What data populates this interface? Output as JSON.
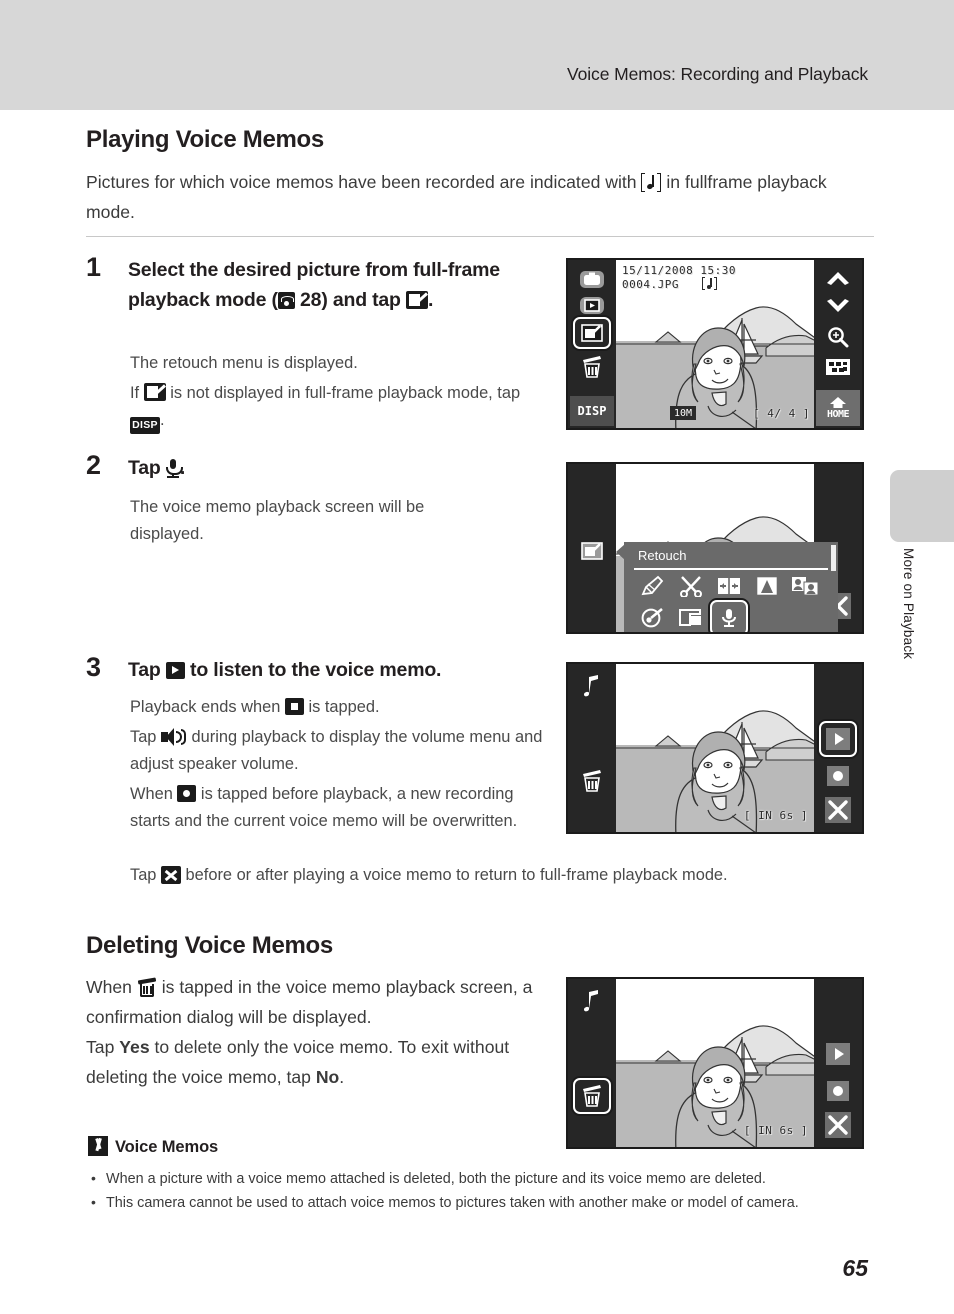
{
  "header": {
    "title": "Voice Memos: Recording and Playback"
  },
  "side_tab": {
    "label": "More on Playback"
  },
  "page_number": "65",
  "sections": {
    "playing": {
      "heading": "Playing Voice Memos",
      "lead_part1": "Pictures for which voice memos have been recorded are indicated with ",
      "lead_part2": " in fullframe playback mode.",
      "steps": [
        {
          "number": "1",
          "title_part1": "Select the desired picture from full-frame playback mode (",
          "title_part2": " 28) and tap ",
          "title_part3": ".",
          "body_line1": "The retouch menu is displayed.",
          "body_line2_part1": "If ",
          "body_line2_part2": " is not displayed in full-frame playback mode, tap ",
          "body_line2_part3": ".",
          "disp_label": "DISP"
        },
        {
          "number": "2",
          "title_part1": "Tap ",
          "title_part3": ".",
          "body_line1": "The voice memo playback screen will be displayed."
        },
        {
          "number": "3",
          "title_part1": "Tap ",
          "title_part3": " to listen to the voice memo.",
          "body_line1_part1": "Playback ends when ",
          "body_line1_part2": " is tapped.",
          "body_line2_part1": "Tap ",
          "body_line2_part2": " during playback to display the volume menu and adjust speaker volume.",
          "body_line3_part1": "When ",
          "body_line3_part2": " is tapped before playback, a new recording starts and the current voice memo will be overwritten.",
          "body_line4_part1": "Tap ",
          "body_line4_part2": " before or after playing a voice memo to return to full-frame playback mode."
        }
      ]
    },
    "deleting": {
      "heading": "Deleting Voice Memos",
      "para1_part1": "When ",
      "para1_part2": " is tapped in the voice memo playback screen, a confirmation dialog will be displayed.",
      "para2_part1": "Tap ",
      "para2_yes": "Yes",
      "para2_part2": " to delete only the voice memo. To exit without deleting the voice memo, tap ",
      "para2_no": "No",
      "para2_part3": "."
    },
    "note": {
      "title": "Voice Memos",
      "bullets": [
        "When a picture with a voice memo attached is deleted, both the picture and its voice memo are deleted.",
        "This camera cannot be used to attach voice memos to pictures taken with another make or model of camera."
      ]
    }
  },
  "lcd_screens": {
    "screen1": {
      "osd_date": "15/11/2008  15:30",
      "osd_file": "0004.JPG",
      "osd_quality": "10M",
      "osd_counter": "[ 4/    4 ]",
      "disp_label": "DISP",
      "home_label": "HOME",
      "left_icons": [
        "camera-icon",
        "playback-icon",
        "retouch-icon",
        "delete-icon",
        "disp-icon"
      ],
      "right_icons": [
        "chevron-up-icon",
        "chevron-down-icon",
        "zoom-in-icon",
        "thumbnail-grid-icon",
        "home-icon"
      ],
      "selected": "retouch-icon"
    },
    "screen2": {
      "menu_title": "Retouch",
      "menu_items": [
        "quick-retouch-icon",
        "crop-icon",
        "d-lighting-icon",
        "bw-filter-icon",
        "skin-softening-icon",
        "paint-icon",
        "small-picture-icon",
        "voice-memo-icon"
      ],
      "selected": "voice-memo-icon",
      "close_icon": "close-icon"
    },
    "screen3": {
      "osd_memo": "[ IN    6s ]",
      "left_icons": [
        "music-note-icon",
        "delete-icon"
      ],
      "right_icons": [
        "play-icon",
        "record-icon",
        "close-icon"
      ],
      "selected": "play-icon"
    },
    "screen4": {
      "osd_memo": "[ IN    6s ]",
      "left_icons": [
        "music-note-icon",
        "delete-icon"
      ],
      "right_icons": [
        "play-icon",
        "record-icon",
        "close-icon"
      ],
      "selected": "delete-icon"
    }
  },
  "colors": {
    "header_band": "#d7d7d7",
    "side_tab": "#cfcfcf",
    "ink": "#231f20",
    "body_text": "#4a4a4a",
    "rule": "#c8c8c8",
    "lcd_frame": "#1b1b1b",
    "lcd_strip": "#262626",
    "menu_bg": "#6a6a6a"
  }
}
